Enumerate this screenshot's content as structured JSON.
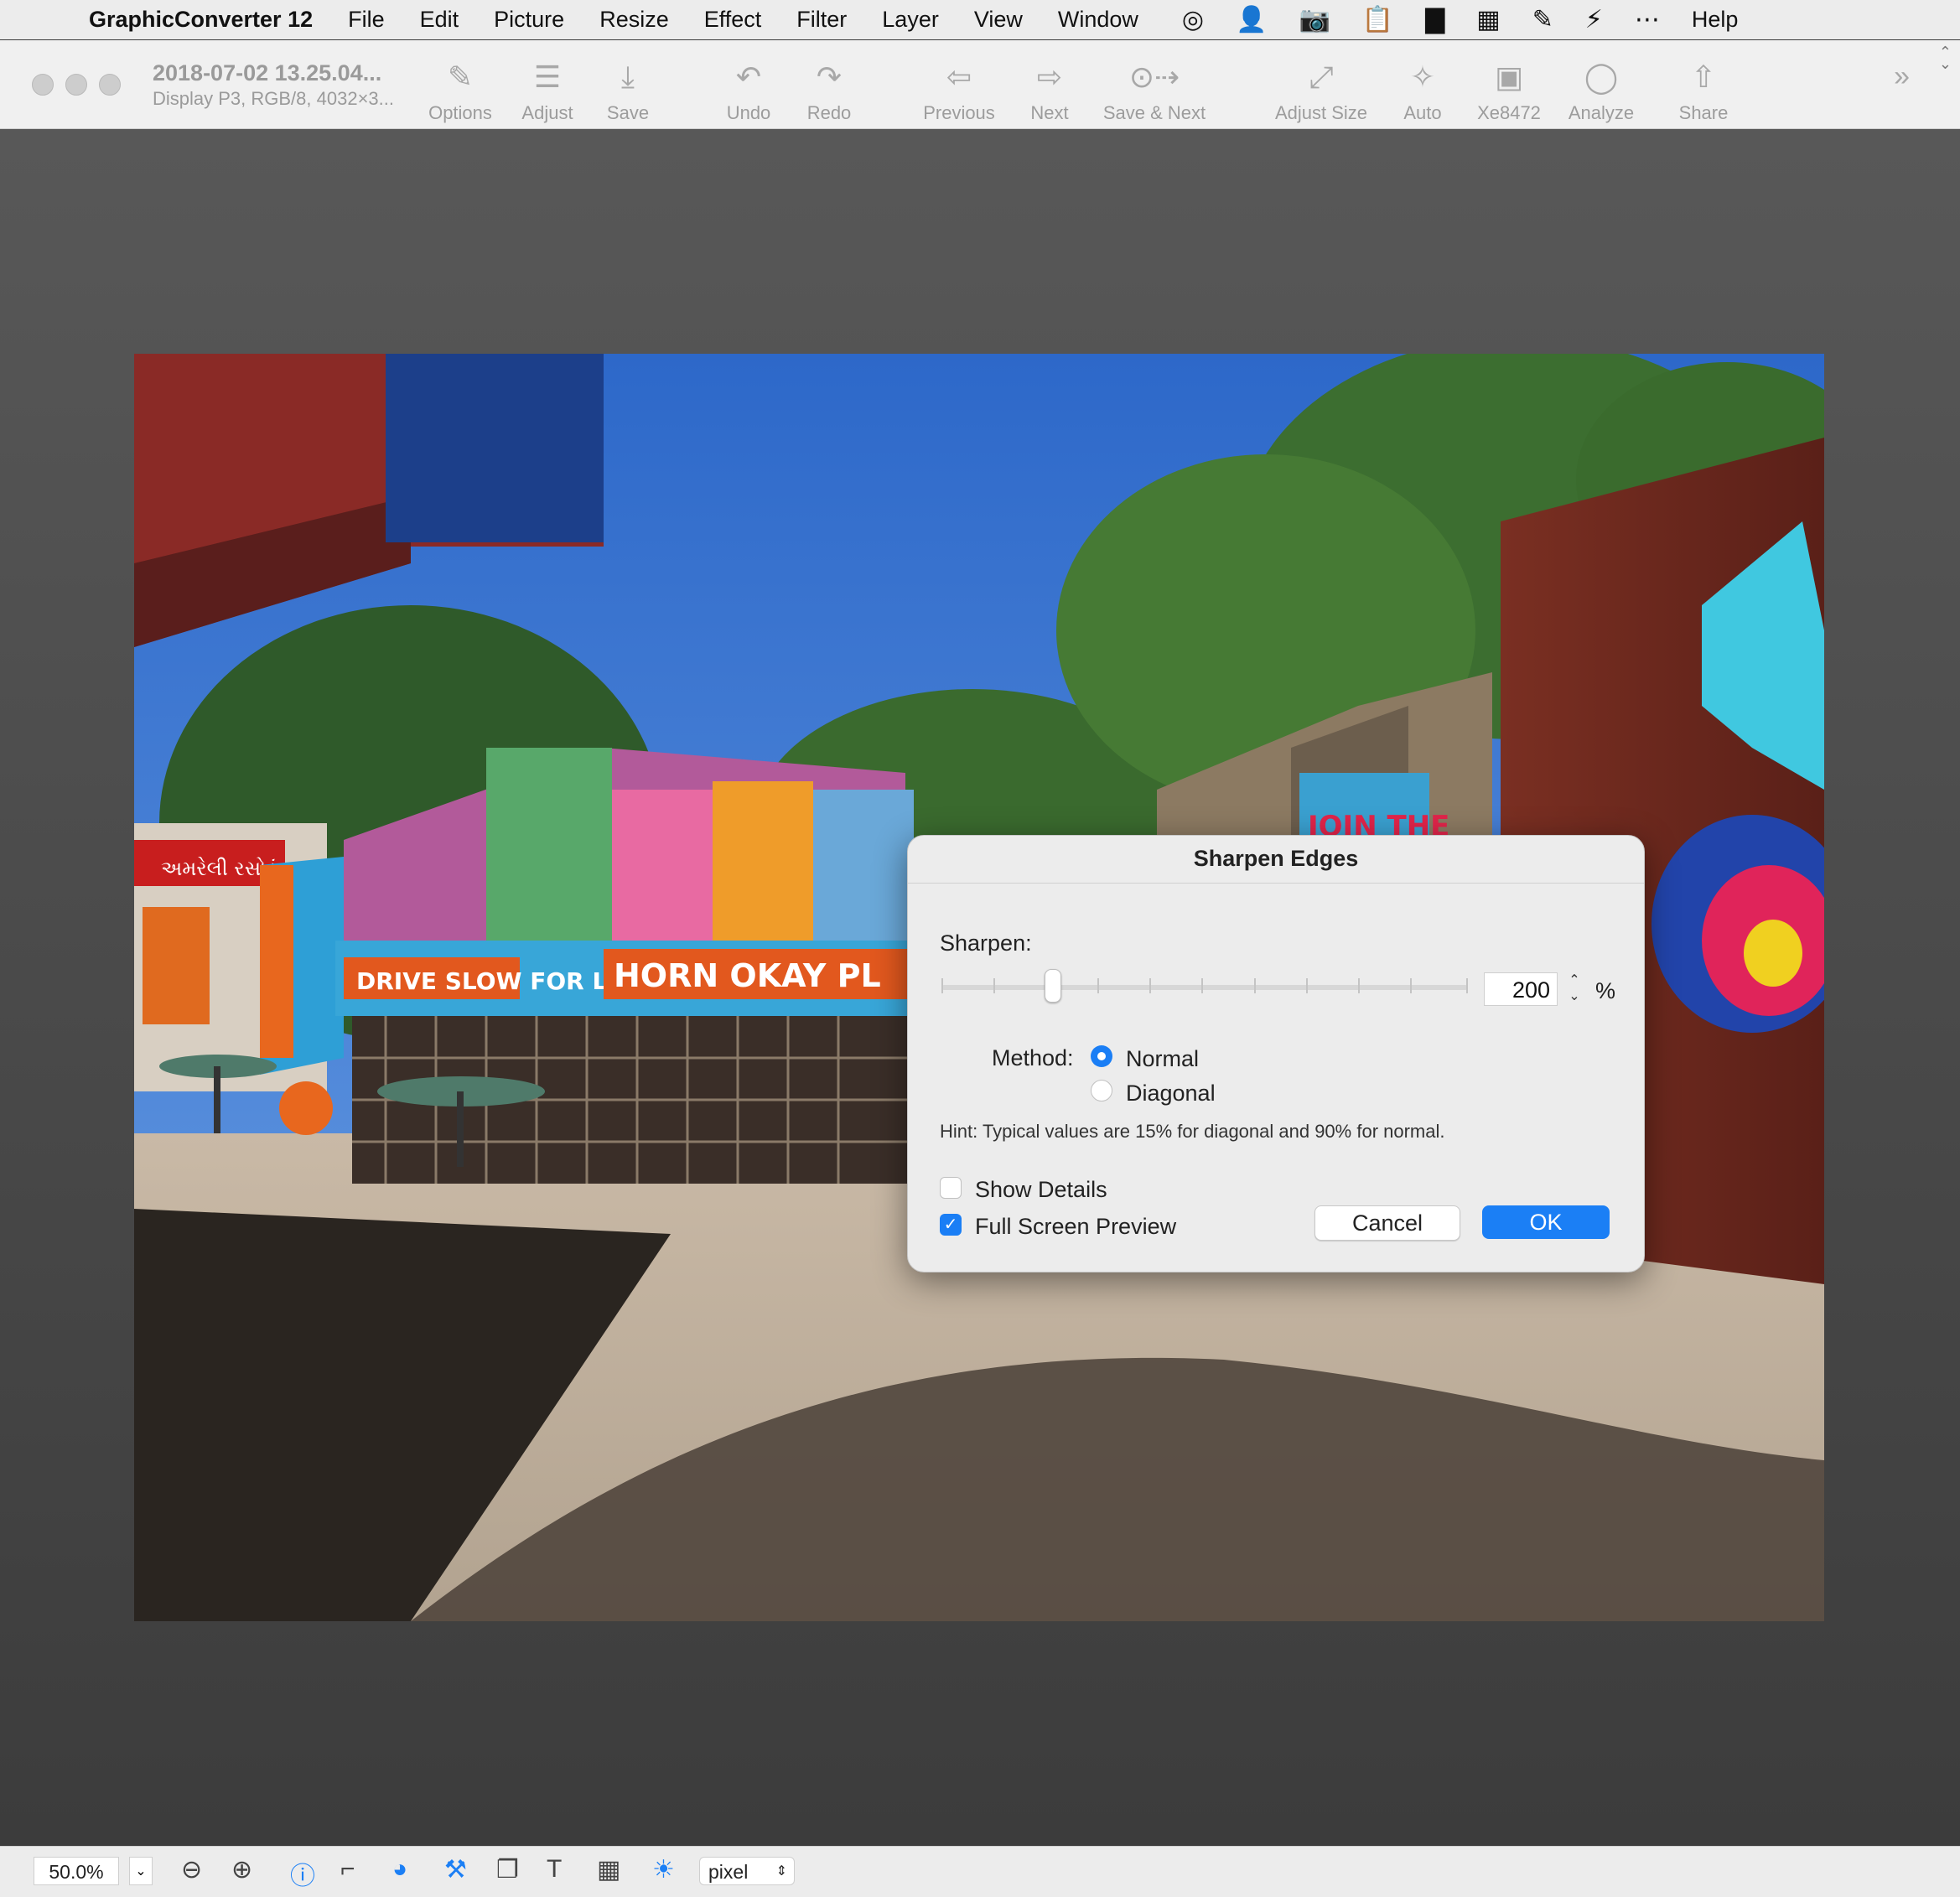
{
  "menubar": {
    "app_name": "GraphicConverter 12",
    "items": [
      "File",
      "Edit",
      "Picture",
      "Resize",
      "Effect",
      "Filter",
      "Layer",
      "View",
      "Window"
    ],
    "help": "Help",
    "status_icons": [
      "target-icon",
      "person-icon",
      "camera-icon",
      "clipboard-icon",
      "box-icon",
      "calendar-icon",
      "brush-icon",
      "bolt-icon",
      "ellipsis-icon"
    ]
  },
  "window": {
    "title": "2018-07-02 13.25.04...",
    "subtitle": "Display P3, RGB/8, 4032×3..."
  },
  "toolbar": {
    "options": "Options",
    "adjust": "Adjust",
    "save": "Save",
    "undo": "Undo",
    "redo": "Redo",
    "previous": "Previous",
    "next": "Next",
    "save_next": "Save & Next",
    "adjust_size": "Adjust Size",
    "auto": "Auto",
    "xe": "Xe8472",
    "analyze": "Analyze",
    "share": "Share"
  },
  "photo": {
    "sign_gujarati": "અમરેલી રસોડું",
    "truck_left": "DRIVE SLOW FOR LIONS",
    "truck_right": "HORN OKAY PL",
    "banner": "JOIN THE"
  },
  "dialog": {
    "title": "Sharpen Edges",
    "sharpen_label": "Sharpen:",
    "sharpen_value": "200",
    "sharpen_fraction": 0.2,
    "percent": "%",
    "method_label": "Method:",
    "method_normal": "Normal",
    "method_diagonal": "Diagonal",
    "method_selected": "Normal",
    "hint": "Hint: Typical values are 15% for diagonal and 90% for normal.",
    "show_details": "Show Details",
    "show_details_checked": false,
    "full_preview": "Full Screen Preview",
    "full_preview_checked": true,
    "cancel": "Cancel",
    "ok": "OK"
  },
  "statusbar": {
    "zoom": "50.0%",
    "unit": "pixel"
  },
  "colors": {
    "accent": "#1b7ff5"
  }
}
